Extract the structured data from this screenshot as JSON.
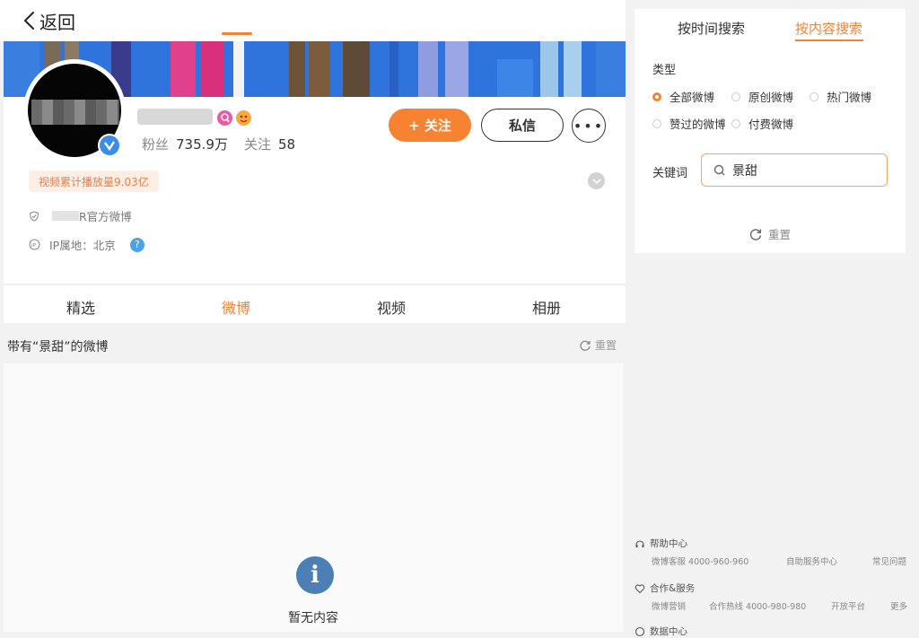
{
  "header": {
    "back_label": "返回"
  },
  "profile": {
    "fans_label": "粉丝",
    "fans_value": "735.9万",
    "following_label": "关注",
    "following_value": "58",
    "follow_button": "+ 关注",
    "message_button": "私信",
    "more_button": "•••",
    "play_count": "视频累计播放量9.03亿",
    "official_suffix": "R官方微博",
    "ip_location": "IP属地：北京",
    "help_icon": "?"
  },
  "tabs": [
    {
      "label": "精选"
    },
    {
      "label": "微博",
      "active": true
    },
    {
      "label": "视频"
    },
    {
      "label": "相册"
    }
  ],
  "results": {
    "title": "带有“景甜”的微博",
    "reset_label": "重置",
    "empty_text": "暂无内容"
  },
  "search_panel": {
    "tab_time": "按时间搜索",
    "tab_content": "按内容搜索",
    "type_label": "类型",
    "options": [
      {
        "label": "全部微博",
        "selected": true
      },
      {
        "label": "原创微博",
        "selected": false
      },
      {
        "label": "热门微博",
        "selected": false
      },
      {
        "label": "赞过的微博",
        "selected": false
      },
      {
        "label": "付费微博",
        "selected": false
      }
    ],
    "keyword_label": "关键词",
    "keyword_value": "景甜",
    "reset_label": "重置"
  },
  "footer": {
    "help_center": "帮助中心",
    "help_items": [
      "微博客服 4000-960-960",
      "自助服务中心",
      "常见问题"
    ],
    "coop_service": "合作&服务",
    "coop_items": [
      "微博营销",
      "合作热线 4000-980-980",
      "开放平台",
      "更多"
    ],
    "data_center": "数据中心"
  },
  "colors": {
    "accent": "#f78332",
    "banner_blue": "#2c6fd8",
    "verified_blue": "#3a8ee8",
    "empty_icon": "#4d7fb7"
  }
}
